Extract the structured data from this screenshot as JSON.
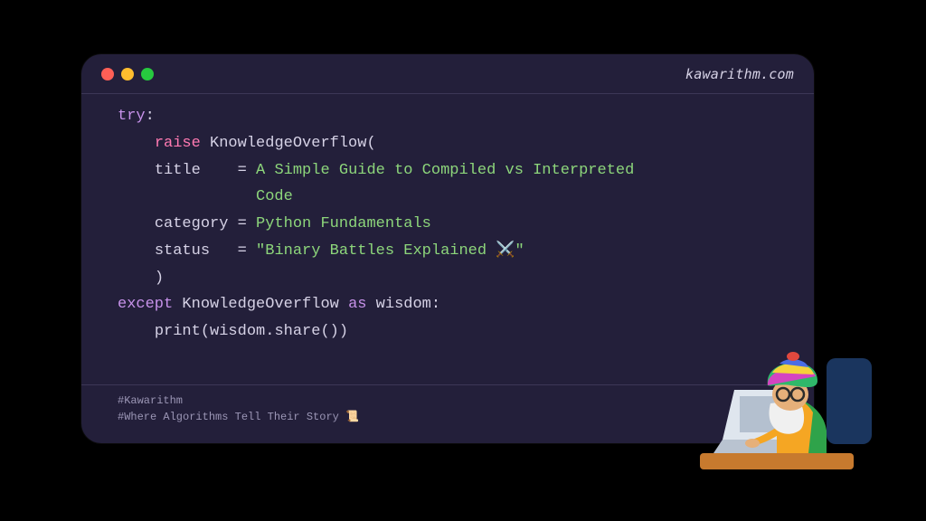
{
  "header": {
    "site": "kawarithm.com"
  },
  "code": {
    "try": "try",
    "colon": ":",
    "raise": "raise",
    "exc_class": "KnowledgeOverflow",
    "open_paren": "(",
    "title_key": "title",
    "eq": "=",
    "title_val1": "A Simple Guide to Compiled vs Interpreted",
    "title_val2": "Code",
    "category_key": "category",
    "category_val": "Python Fundamentals",
    "status_key": "status",
    "status_val": "\"Binary Battles Explained ⚔️\"",
    "close_paren": ")",
    "except": "except",
    "as": "as",
    "wisdom": "wisdom",
    "print": "print",
    "share_call": "(wisdom.share())"
  },
  "footer": {
    "tag1": "#Kawarithm",
    "tag2": "#Where Algorithms Tell Their Story 📜"
  },
  "illustration": {
    "alt": "elder-coder-with-turban-at-laptop"
  }
}
